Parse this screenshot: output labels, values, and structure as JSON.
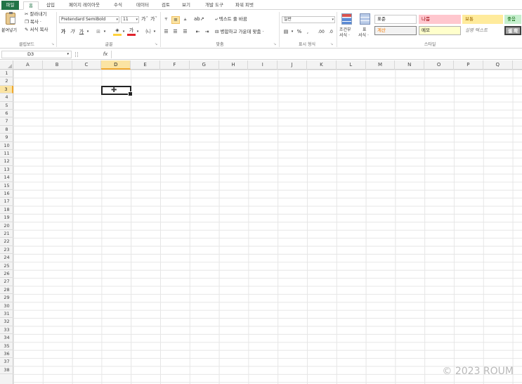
{
  "tabs": [
    "파일",
    "홈",
    "삽입",
    "페이지 레이아웃",
    "수식",
    "데이터",
    "검토",
    "보기",
    "개발 도구",
    "파워 피벗"
  ],
  "active_tab": "홈",
  "clipboard": {
    "paste_label": "붙여넣기",
    "cut_label": "잘라내기",
    "copy_label": "복사 ·",
    "format_painter_label": "서식 복사",
    "group_label": "클립보드"
  },
  "font": {
    "font_name": "Pretendard SemiBold",
    "font_size": "11",
    "grow_label": "가ˆ",
    "shrink_label": "가ˇ",
    "bold_label": "가",
    "italic_label": "가",
    "underline_label": "가",
    "group_label": "글꼴"
  },
  "alignment": {
    "wrap_text_label": "텍스트 줄 바꿈",
    "merge_center_label": "병합하고 가운데 맞춤 ·",
    "group_label": "맞춤"
  },
  "number": {
    "format_value": "일반",
    "percent_label": "%",
    "comma_label": ",",
    "group_label": "표시 형식"
  },
  "styles_group": {
    "conditional_label_1": "조건부",
    "conditional_label_2": "서식 ·",
    "table_label_1": "표",
    "table_label_2": "서식 ·",
    "group_label": "스타일",
    "cells": [
      {
        "label": "표준",
        "bg": "#ffffff",
        "fg": "#222222",
        "border": "#c8c8c8"
      },
      {
        "label": "나쁨",
        "bg": "#ffc7ce",
        "fg": "#9c0006",
        "border": "#ffc7ce"
      },
      {
        "label": "보통",
        "bg": "#ffeb9c",
        "fg": "#9c6500",
        "border": "#ffeb9c"
      },
      {
        "label": "좋음",
        "bg": "#c6efce",
        "fg": "#006100",
        "border": "#c6efce"
      },
      {
        "label": "계산",
        "bg": "#f2f2f2",
        "fg": "#fa7d00",
        "border": "#7f7f7f"
      },
      {
        "label": "메모",
        "bg": "#ffffcc",
        "fg": "#222222",
        "border": "#b2b2b2"
      },
      {
        "label": "설명 텍스트",
        "bg": "#ffffff",
        "fg": "#7f7f7f",
        "border": "#ffffff"
      },
      {
        "label": "셀 확",
        "bg": "#a5a5a5",
        "fg": "#ffffff",
        "border": "#3f3f3f"
      }
    ]
  },
  "formula_bar": {
    "name_box": "D3",
    "fx_label": "fx",
    "formula_value": ""
  },
  "columns": [
    "A",
    "B",
    "C",
    "D",
    "E",
    "F",
    "G",
    "H",
    "I",
    "J",
    "K",
    "L",
    "M",
    "N",
    "O",
    "P",
    "Q"
  ],
  "rows": [
    "1",
    "2",
    "3",
    "4",
    "5",
    "6",
    "7",
    "8",
    "9",
    "10",
    "11",
    "12",
    "13",
    "14",
    "15",
    "16",
    "17",
    "18",
    "19",
    "20",
    "21",
    "22",
    "23",
    "24",
    "25",
    "26",
    "27",
    "28",
    "29",
    "30",
    "31",
    "32",
    "33",
    "34",
    "35",
    "36",
    "37",
    "38"
  ],
  "selected_cell": {
    "column": "D",
    "row": "3"
  },
  "watermark": "© 2023 ROUM"
}
